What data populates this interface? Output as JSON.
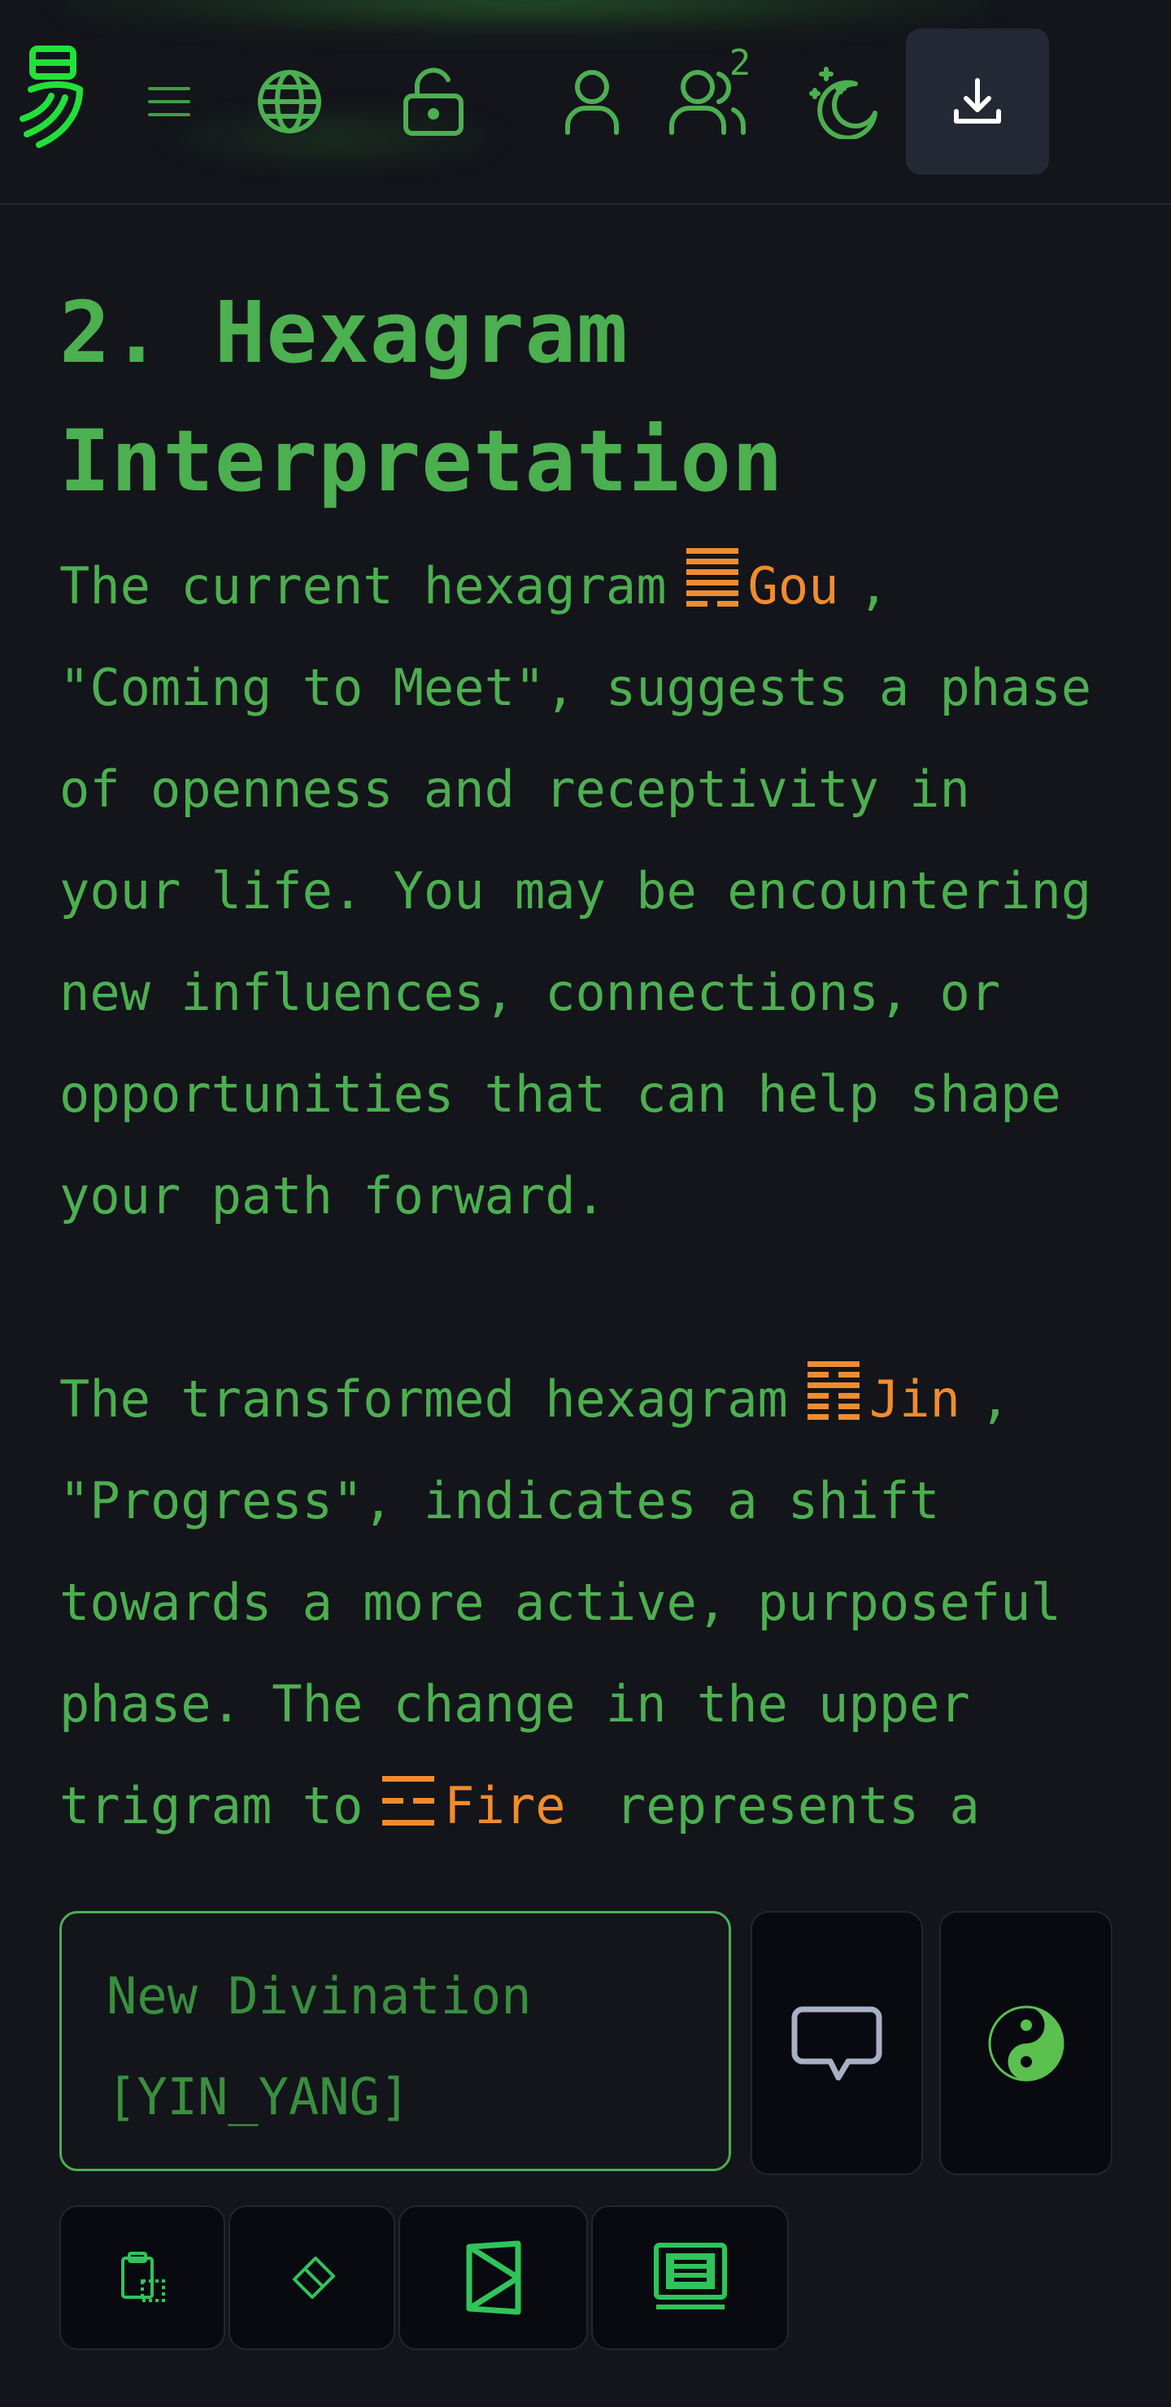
{
  "header": {
    "logo": "yi-logo-icon",
    "icons": [
      "menu-icon",
      "globe-icon",
      "unlock-icon",
      "user-icon",
      "users-icon",
      "moon-stars-icon",
      "download-icon"
    ],
    "users_badge": "2"
  },
  "content": {
    "heading": "2. Hexagram Interpretation",
    "para1": {
      "prefix": "The current hexagram",
      "hexagram_name": "Gou",
      "suffix": ",",
      "body": "\"Coming to Meet\", suggests a phase of openness and receptivity in your life. You may be encountering new influences, connections, or opportunities that can help shape your path forward."
    },
    "para2": {
      "prefix": "The transformed hexagram",
      "hexagram_name": "Jin",
      "suffix": ",",
      "body": "\"Progress\", indicates a shift towards a more active, purposeful phase. The change in the upper trigram to",
      "trigram_name": "Fire",
      "tail": "represents a"
    }
  },
  "input": {
    "placeholder": "New Divination\n[YIN_YANG]"
  },
  "toolbar": {
    "icons": [
      "chat-icon",
      "yin-yang-icon",
      "clipboard-icon",
      "eraser-icon",
      "hourglass-icon",
      "terminal-icon"
    ]
  },
  "colors": {
    "background": "#13151a",
    "accent_green": "#4caf50",
    "hexagram_orange": "#f08c2e",
    "panel": "#080a10"
  }
}
